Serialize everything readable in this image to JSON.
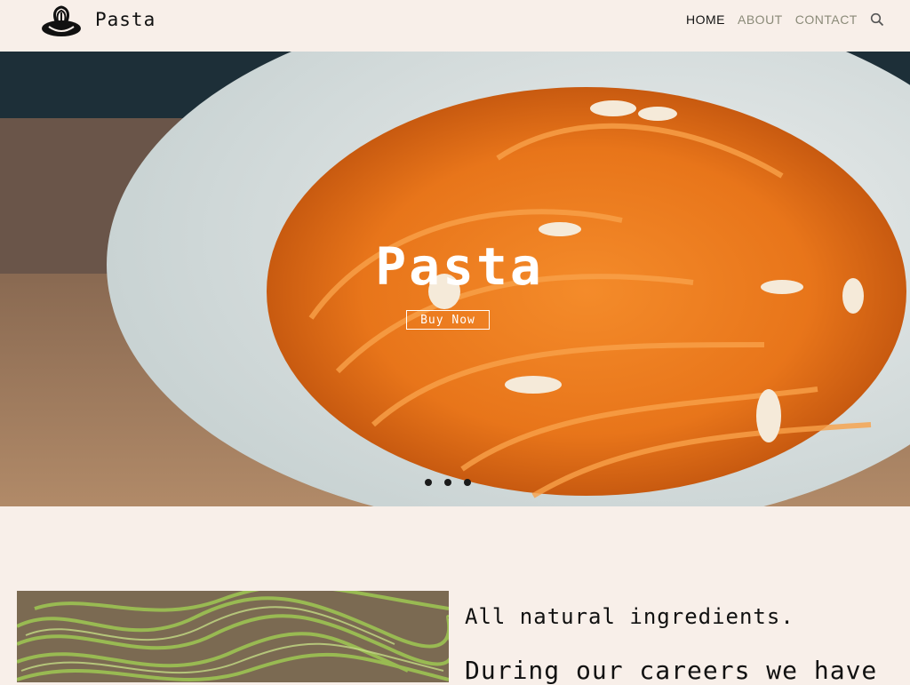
{
  "header": {
    "site_title": "Pasta",
    "logo_icon": "pasta-bowl-logo-icon",
    "nav": {
      "home": "HOME",
      "about": "ABOUT",
      "contact": "CONTACT"
    },
    "search_icon": "search-icon"
  },
  "hero": {
    "title": "Pasta",
    "button_label": "Buy Now",
    "slide_count": 3,
    "active_slide": 1
  },
  "feature": {
    "heading": "All natural ingredients.",
    "text": "During our careers we have"
  },
  "colors": {
    "page_background": "#f8efe9",
    "nav_active": "#111111",
    "nav_inactive": "#8a8a78",
    "hero_text": "#ffffff"
  }
}
